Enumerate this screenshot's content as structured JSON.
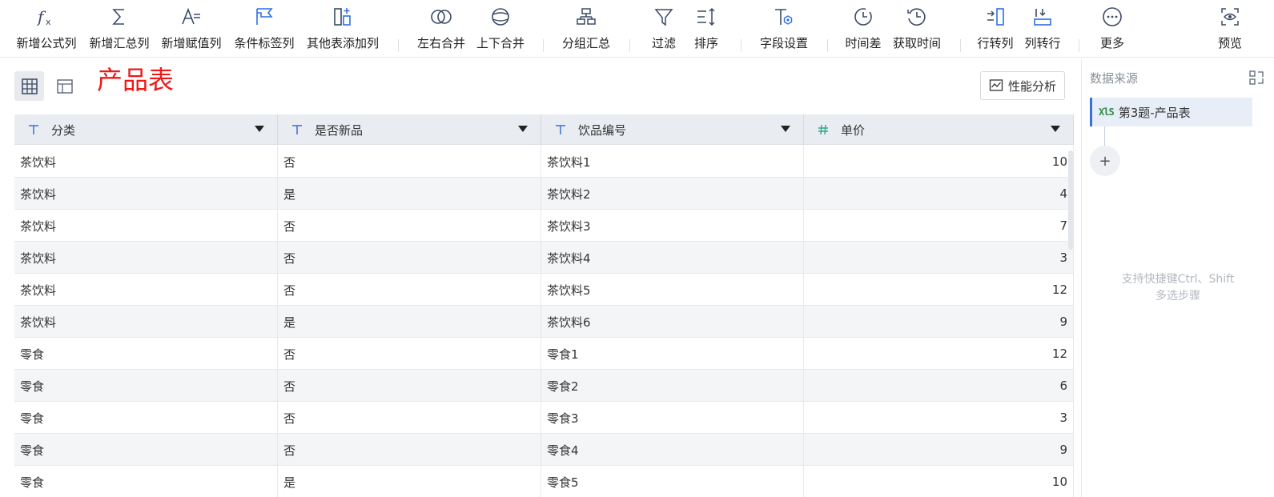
{
  "toolbar": {
    "items": [
      {
        "label": "新增公式列",
        "icon": "formula-icon"
      },
      {
        "label": "新增汇总列",
        "icon": "sigma-icon"
      },
      {
        "label": "新增赋值列",
        "icon": "assign-value-icon"
      },
      {
        "label": "条件标签列",
        "icon": "condition-tag-icon"
      },
      {
        "label": "其他表添加列",
        "icon": "add-column-other-table-icon"
      },
      {
        "label": "左右合并",
        "icon": "merge-horizontal-icon"
      },
      {
        "label": "上下合并",
        "icon": "merge-vertical-icon"
      },
      {
        "label": "分组汇总",
        "icon": "group-summary-icon"
      },
      {
        "label": "过滤",
        "icon": "filter-icon"
      },
      {
        "label": "排序",
        "icon": "sort-icon"
      },
      {
        "label": "字段设置",
        "icon": "field-settings-icon"
      },
      {
        "label": "时间差",
        "icon": "time-diff-icon"
      },
      {
        "label": "获取时间",
        "icon": "get-time-icon"
      },
      {
        "label": "行转列",
        "icon": "row-to-column-icon"
      },
      {
        "label": "列转行",
        "icon": "column-to-row-icon"
      },
      {
        "label": "更多",
        "icon": "more-icon"
      },
      {
        "label": "预览",
        "icon": "preview-eye-icon"
      }
    ]
  },
  "page": {
    "title": "产品表",
    "performance_button": "性能分析"
  },
  "table": {
    "columns": [
      {
        "label": "分类",
        "type": "text"
      },
      {
        "label": "是否新品",
        "type": "text"
      },
      {
        "label": "饮品编号",
        "type": "text"
      },
      {
        "label": "单价",
        "type": "number"
      }
    ],
    "rows": [
      [
        "茶饮料",
        "否",
        "茶饮料1",
        "10"
      ],
      [
        "茶饮料",
        "是",
        "茶饮料2",
        "4"
      ],
      [
        "茶饮料",
        "否",
        "茶饮料3",
        "7"
      ],
      [
        "茶饮料",
        "否",
        "茶饮料4",
        "3"
      ],
      [
        "茶饮料",
        "否",
        "茶饮料5",
        "12"
      ],
      [
        "茶饮料",
        "是",
        "茶饮料6",
        "9"
      ],
      [
        "零食",
        "否",
        "零食1",
        "12"
      ],
      [
        "零食",
        "否",
        "零食2",
        "6"
      ],
      [
        "零食",
        "否",
        "零食3",
        "3"
      ],
      [
        "零食",
        "否",
        "零食4",
        "9"
      ],
      [
        "零食",
        "是",
        "零食5",
        "10"
      ]
    ]
  },
  "side_panel": {
    "title": "数据来源",
    "source_badge": "XlS",
    "source_name": "第3题-产品表",
    "add_step": "+",
    "hint_line1": "支持快捷键Ctrl、Shift",
    "hint_line2": "多选步骤"
  },
  "colors": {
    "accent": "#3a6fd8",
    "title_red": "#f01818",
    "header_bg": "#e9edf2",
    "row_alt": "#f3f5f7"
  }
}
